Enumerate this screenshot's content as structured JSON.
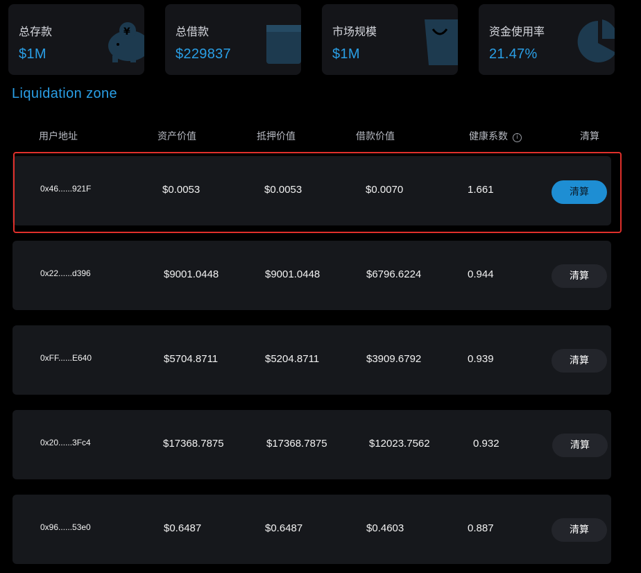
{
  "stats": [
    {
      "label": "总存款",
      "value": "$1M",
      "icon": "piggy-bank-icon"
    },
    {
      "label": "总借款",
      "value": "$229837",
      "icon": "wallet-icon"
    },
    {
      "label": "市场规模",
      "value": "$1M",
      "icon": "shopping-bag-icon"
    },
    {
      "label": "资金使用率",
      "value": "21.47%",
      "icon": "pie-chart-icon"
    }
  ],
  "section_title": "Liquidation zone",
  "table": {
    "headers": {
      "address": "用户地址",
      "asset_value": "资产价值",
      "collateral_value": "抵押价值",
      "borrow_value": "借款价值",
      "health": "健康系数",
      "health_info": "i",
      "action": "清算"
    },
    "rows": [
      {
        "address": "0x46......921F",
        "asset": "$0.0053",
        "collateral": "$0.0053",
        "borrow": "$0.0070",
        "health": "1.661",
        "button": "清算",
        "highlighted": true
      },
      {
        "address": "0x22......d396",
        "asset": "$9001.0448",
        "collateral": "$9001.0448",
        "borrow": "$6796.6224",
        "health": "0.944",
        "button": "清算"
      },
      {
        "address": "0xFF......E640",
        "asset": "$5704.8711",
        "collateral": "$5204.8711",
        "borrow": "$3909.6792",
        "health": "0.939",
        "button": "清算"
      },
      {
        "address": "0x20......3Fc4",
        "asset": "$17368.7875",
        "collateral": "$17368.7875",
        "borrow": "$12023.7562",
        "health": "0.932",
        "button": "清算"
      },
      {
        "address": "0x96......53e0",
        "asset": "$0.6487",
        "collateral": "$0.6487",
        "borrow": "$0.4603",
        "health": "0.887",
        "button": "清算"
      }
    ]
  },
  "colors": {
    "accent": "#2a9fe6",
    "primary_button": "#1e8ed3",
    "highlight_border": "#e0302b",
    "card_bg": "#141519",
    "row_bg": "#16181c"
  }
}
